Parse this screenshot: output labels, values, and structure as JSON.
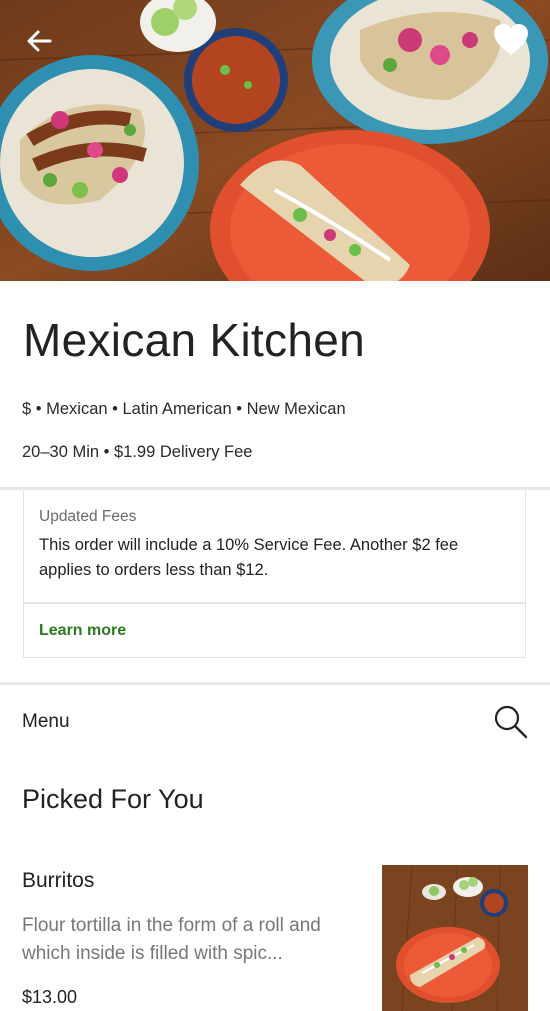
{
  "restaurant": {
    "name": "Mexican Kitchen",
    "meta": "$ • Mexican • Latin American • New Mexican",
    "delivery": "20–30 Min • $1.99 Delivery Fee"
  },
  "fees_notice": {
    "heading": "Updated Fees",
    "body": "This order will include a 10% Service Fee. Another $2 fee applies to orders less than $12.",
    "link": "Learn more"
  },
  "menu": {
    "label": "Menu",
    "section_title": "Picked For You",
    "items": [
      {
        "name": "Burritos",
        "description": "Flour tortilla in the form of a roll and which inside is filled with spic...",
        "price": "$13.00"
      }
    ]
  },
  "icons": {
    "back": "arrow-left-icon",
    "favorite": "heart-icon",
    "search": "search-icon"
  },
  "colors": {
    "link_green": "#2b7a1c",
    "divider": "#e7e7e7",
    "text_primary": "#222222",
    "text_secondary": "#777777"
  }
}
